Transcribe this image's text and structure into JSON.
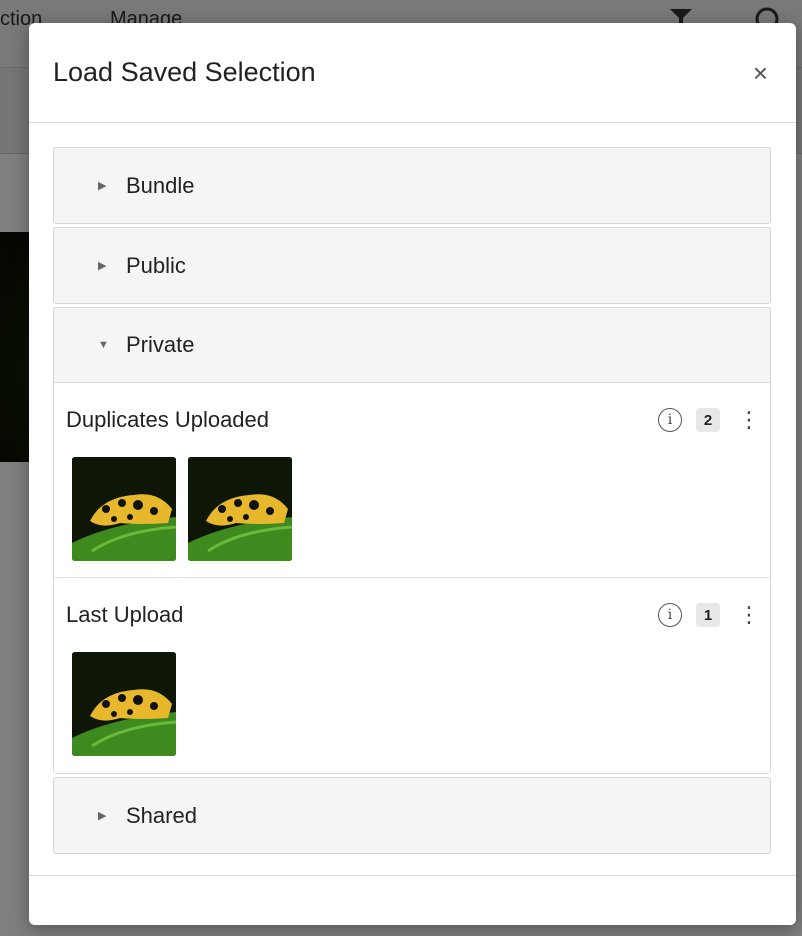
{
  "background": {
    "tabs": [
      "ction",
      "Manage"
    ]
  },
  "modal": {
    "title": "Load Saved Selection",
    "close_label": "×"
  },
  "accordion": {
    "sections": [
      {
        "label": "Bundle",
        "expanded": false
      },
      {
        "label": "Public",
        "expanded": false
      },
      {
        "label": "Private",
        "expanded": true
      },
      {
        "label": "Shared",
        "expanded": false
      }
    ]
  },
  "private_selections": [
    {
      "name": "Duplicates Uploaded",
      "count": "2",
      "thumbnails": 2
    },
    {
      "name": "Last Upload",
      "count": "1",
      "thumbnails": 1
    }
  ],
  "icons": {
    "expanded_caret": "caret-down-icon",
    "collapsed_caret": "caret-right-icon",
    "info": "info-icon",
    "menu": "kebab-menu-icon",
    "close": "close-icon"
  },
  "colors": {
    "overlay": "#7a7a7a",
    "panel_header": "#f5f5f5",
    "border": "#d6d6d6",
    "frog_yellow": "#e8b82c",
    "leaf_green": "#3f8a1f"
  }
}
